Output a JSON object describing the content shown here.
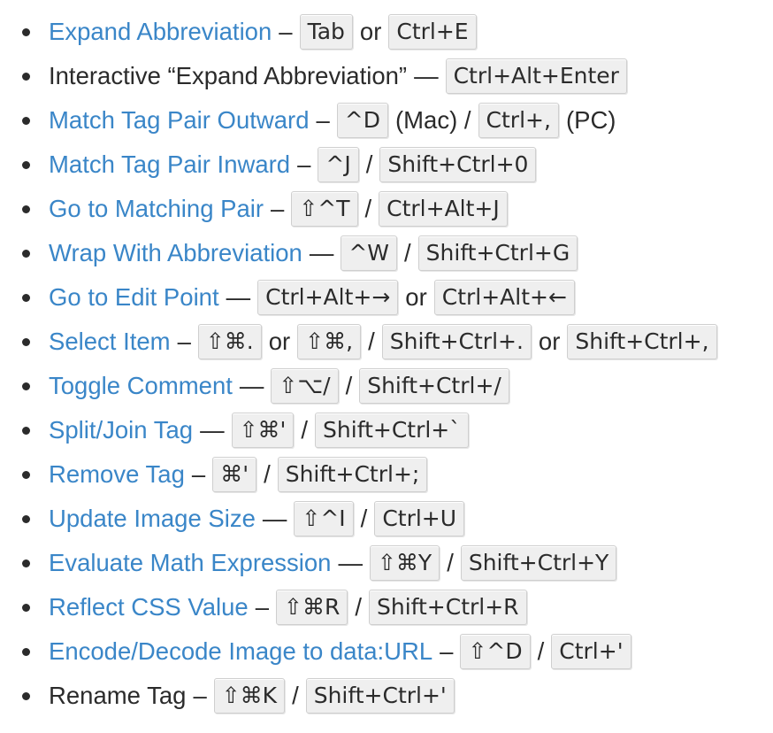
{
  "items": [
    {
      "label": "Expand Abbreviation",
      "link": true,
      "dash": "–",
      "parts": [
        {
          "k": "Tab"
        },
        {
          "t": "or"
        },
        {
          "k": "Ctrl+E"
        }
      ]
    },
    {
      "label": "Interactive “Expand Abbreviation”",
      "link": false,
      "dash": "—",
      "parts": [
        {
          "k": "Ctrl+Alt+Enter"
        }
      ]
    },
    {
      "label": "Match Tag Pair Outward",
      "link": true,
      "dash": "–",
      "parts": [
        {
          "k": "^D"
        },
        {
          "t": "(Mac) /"
        },
        {
          "k": "Ctrl+,"
        },
        {
          "s": "(PC)"
        }
      ]
    },
    {
      "label": "Match Tag Pair Inward",
      "link": true,
      "dash": "–",
      "parts": [
        {
          "k": "^J"
        },
        {
          "t": "/"
        },
        {
          "k": "Shift+Ctrl+0"
        }
      ]
    },
    {
      "label": "Go to Matching Pair",
      "link": true,
      "dash": "–",
      "parts": [
        {
          "k": "⇧^T"
        },
        {
          "t": "/"
        },
        {
          "k": "Ctrl+Alt+J"
        }
      ]
    },
    {
      "label": "Wrap With Abbreviation",
      "link": true,
      "dash": "—",
      "parts": [
        {
          "k": "^W"
        },
        {
          "t": "/"
        },
        {
          "k": "Shift+Ctrl+G"
        }
      ]
    },
    {
      "label": "Go to Edit Point",
      "link": true,
      "dash": "—",
      "parts": [
        {
          "k": "Ctrl+Alt+→"
        },
        {
          "t": "or"
        },
        {
          "k": "Ctrl+Alt+←"
        }
      ]
    },
    {
      "label": "Select Item",
      "link": true,
      "dash": "–",
      "parts": [
        {
          "k": "⇧⌘."
        },
        {
          "t": "or"
        },
        {
          "k": "⇧⌘,"
        },
        {
          "t": "/"
        },
        {
          "k": "Shift+Ctrl+."
        },
        {
          "t": "or"
        },
        {
          "k": "Shift+Ctrl+,"
        }
      ]
    },
    {
      "label": "Toggle Comment",
      "link": true,
      "dash": "—",
      "parts": [
        {
          "k": "⇧⌥/"
        },
        {
          "t": "/"
        },
        {
          "k": "Shift+Ctrl+/"
        }
      ]
    },
    {
      "label": "Split/Join Tag",
      "link": true,
      "dash": "—",
      "parts": [
        {
          "k": "⇧⌘'"
        },
        {
          "t": "/"
        },
        {
          "k": "Shift+Ctrl+`"
        }
      ]
    },
    {
      "label": "Remove Tag",
      "link": true,
      "dash": "–",
      "parts": [
        {
          "k": "⌘'"
        },
        {
          "t": "/"
        },
        {
          "k": "Shift+Ctrl+;"
        }
      ]
    },
    {
      "label": "Update Image Size",
      "link": true,
      "dash": "—",
      "parts": [
        {
          "k": "⇧^I"
        },
        {
          "t": "/"
        },
        {
          "k": "Ctrl+U"
        }
      ]
    },
    {
      "label": "Evaluate Math Expression",
      "link": true,
      "dash": "—",
      "parts": [
        {
          "k": "⇧⌘Y"
        },
        {
          "t": "/"
        },
        {
          "k": "Shift+Ctrl+Y"
        }
      ]
    },
    {
      "label": "Reflect CSS Value",
      "link": true,
      "dash": "–",
      "parts": [
        {
          "k": "⇧⌘R"
        },
        {
          "t": "/"
        },
        {
          "k": "Shift+Ctrl+R"
        }
      ]
    },
    {
      "label": "Encode/Decode Image to data:URL",
      "link": true,
      "dash": "–",
      "parts": [
        {
          "k": "⇧^D"
        },
        {
          "t": "/"
        },
        {
          "k": "Ctrl+'"
        }
      ]
    },
    {
      "label": "Rename Tag",
      "link": false,
      "dash": "–",
      "parts": [
        {
          "k": "⇧⌘K"
        },
        {
          "t": "/"
        },
        {
          "k": "Shift+Ctrl+'"
        }
      ]
    }
  ],
  "colors": {
    "link": "#3a86c8",
    "text": "#2b2b2b",
    "key_bg": "#efefef",
    "key_border": "#cfcfcf"
  }
}
